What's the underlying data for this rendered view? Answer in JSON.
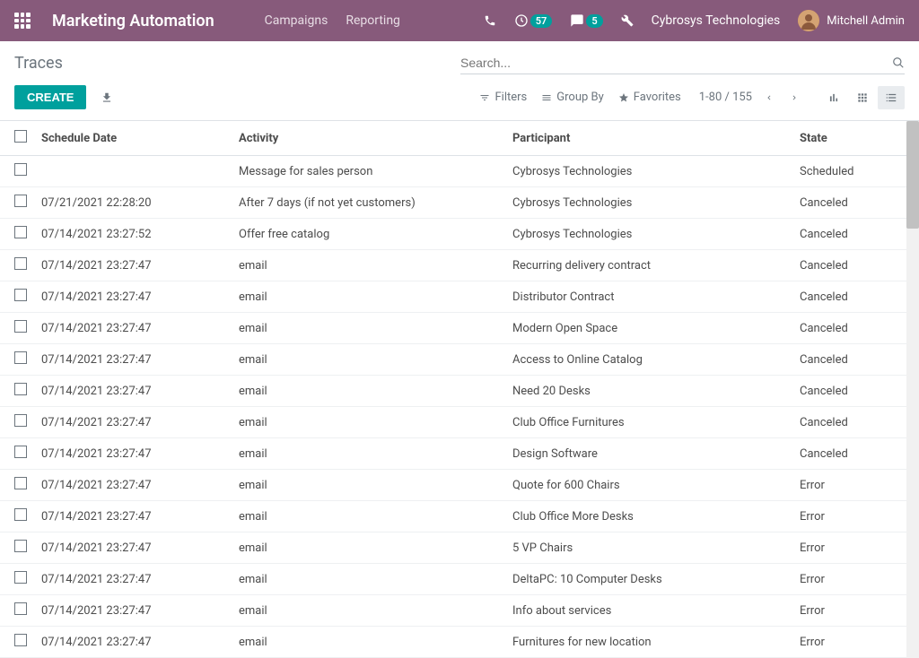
{
  "header": {
    "app_title": "Marketing Automation",
    "nav": [
      "Campaigns",
      "Reporting"
    ],
    "badge_clock": "57",
    "badge_chat": "5",
    "company": "Cybrosys Technologies",
    "user": "Mitchell Admin"
  },
  "control": {
    "breadcrumb": "Traces",
    "search_placeholder": "Search...",
    "create_label": "CREATE",
    "filters_label": "Filters",
    "groupby_label": "Group By",
    "favorites_label": "Favorites",
    "pager": "1-80 / 155"
  },
  "table": {
    "headers": {
      "schedule_date": "Schedule Date",
      "activity": "Activity",
      "participant": "Participant",
      "state": "State"
    },
    "rows": [
      {
        "date": "",
        "activity": "Message for sales person",
        "participant": "Cybrosys Technologies",
        "state": "Scheduled"
      },
      {
        "date": "07/21/2021 22:28:20",
        "activity": "After 7 days (if not yet customers)",
        "participant": "Cybrosys Technologies",
        "state": "Canceled"
      },
      {
        "date": "07/14/2021 23:27:52",
        "activity": "Offer free catalog",
        "participant": "Cybrosys Technologies",
        "state": "Canceled"
      },
      {
        "date": "07/14/2021 23:27:47",
        "activity": "email",
        "participant": "Recurring delivery contract",
        "state": "Canceled"
      },
      {
        "date": "07/14/2021 23:27:47",
        "activity": "email",
        "participant": "Distributor Contract",
        "state": "Canceled"
      },
      {
        "date": "07/14/2021 23:27:47",
        "activity": "email",
        "participant": "Modern Open Space",
        "state": "Canceled"
      },
      {
        "date": "07/14/2021 23:27:47",
        "activity": "email",
        "participant": "Access to Online Catalog",
        "state": "Canceled"
      },
      {
        "date": "07/14/2021 23:27:47",
        "activity": "email",
        "participant": "Need 20 Desks",
        "state": "Canceled"
      },
      {
        "date": "07/14/2021 23:27:47",
        "activity": "email",
        "participant": "Club Office Furnitures",
        "state": "Canceled"
      },
      {
        "date": "07/14/2021 23:27:47",
        "activity": "email",
        "participant": "Design Software",
        "state": "Canceled"
      },
      {
        "date": "07/14/2021 23:27:47",
        "activity": "email",
        "participant": "Quote for 600 Chairs",
        "state": "Error"
      },
      {
        "date": "07/14/2021 23:27:47",
        "activity": "email",
        "participant": "Club Office More Desks",
        "state": "Error"
      },
      {
        "date": "07/14/2021 23:27:47",
        "activity": "email",
        "participant": "5 VP Chairs",
        "state": "Error"
      },
      {
        "date": "07/14/2021 23:27:47",
        "activity": "email",
        "participant": "DeltaPC: 10 Computer Desks",
        "state": "Error"
      },
      {
        "date": "07/14/2021 23:27:47",
        "activity": "email",
        "participant": "Info about services",
        "state": "Error"
      },
      {
        "date": "07/14/2021 23:27:47",
        "activity": "email",
        "participant": "Furnitures for new location",
        "state": "Error"
      }
    ]
  }
}
